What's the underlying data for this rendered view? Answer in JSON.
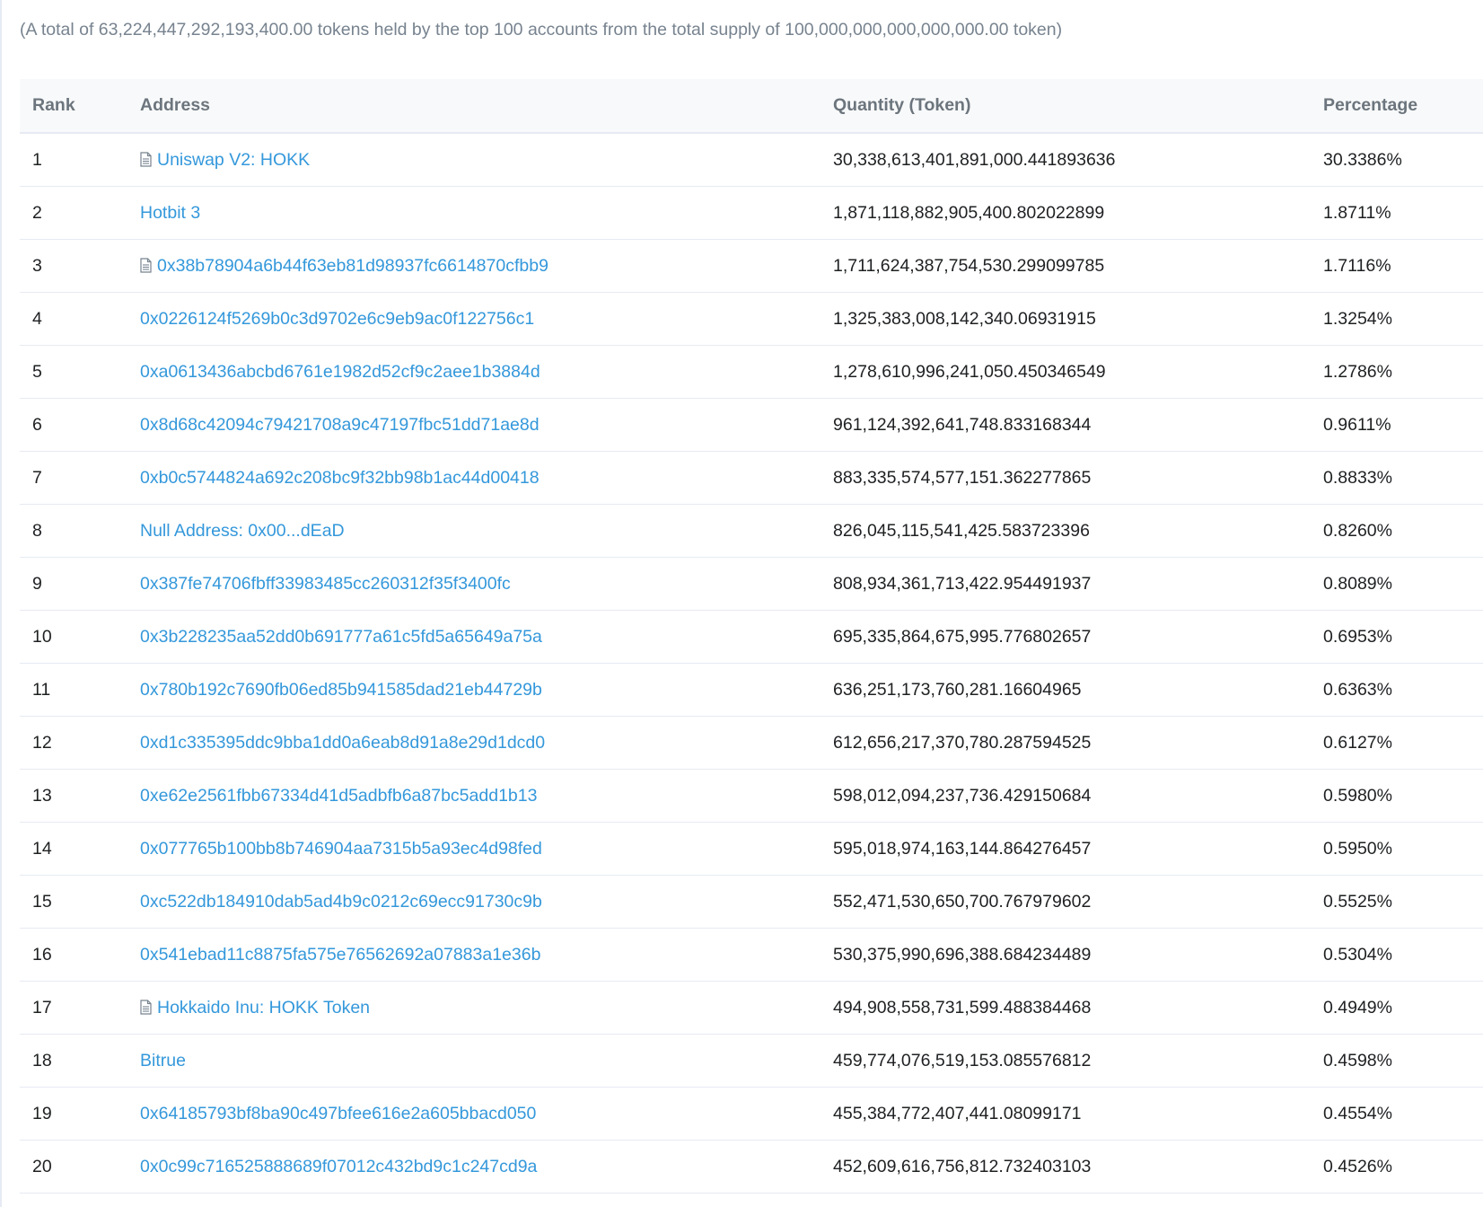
{
  "summary": "(A total of 63,224,447,292,193,400.00 tokens held by the top 100 accounts from the total supply of 100,000,000,000,000,000.00 token)",
  "columns": {
    "rank": "Rank",
    "address": "Address",
    "quantity": "Quantity (Token)",
    "percentage": "Percentage"
  },
  "rows": [
    {
      "rank": "1",
      "address": "Uniswap V2: HOKK",
      "contract": true,
      "quantity": "30,338,613,401,891,000.441893636",
      "percentage": "30.3386%"
    },
    {
      "rank": "2",
      "address": "Hotbit 3",
      "contract": false,
      "quantity": "1,871,118,882,905,400.802022899",
      "percentage": "1.8711%"
    },
    {
      "rank": "3",
      "address": "0x38b78904a6b44f63eb81d98937fc6614870cfbb9",
      "contract": true,
      "quantity": "1,711,624,387,754,530.299099785",
      "percentage": "1.7116%"
    },
    {
      "rank": "4",
      "address": "0x0226124f5269b0c3d9702e6c9eb9ac0f122756c1",
      "contract": false,
      "quantity": "1,325,383,008,142,340.06931915",
      "percentage": "1.3254%"
    },
    {
      "rank": "5",
      "address": "0xa0613436abcbd6761e1982d52cf9c2aee1b3884d",
      "contract": false,
      "quantity": "1,278,610,996,241,050.450346549",
      "percentage": "1.2786%"
    },
    {
      "rank": "6",
      "address": "0x8d68c42094c79421708a9c47197fbc51dd71ae8d",
      "contract": false,
      "quantity": "961,124,392,641,748.833168344",
      "percentage": "0.9611%"
    },
    {
      "rank": "7",
      "address": "0xb0c5744824a692c208bc9f32bb98b1ac44d00418",
      "contract": false,
      "quantity": "883,335,574,577,151.362277865",
      "percentage": "0.8833%"
    },
    {
      "rank": "8",
      "address": "Null Address: 0x00...dEaD",
      "contract": false,
      "quantity": "826,045,115,541,425.583723396",
      "percentage": "0.8260%"
    },
    {
      "rank": "9",
      "address": "0x387fe74706fbff33983485cc260312f35f3400fc",
      "contract": false,
      "quantity": "808,934,361,713,422.954491937",
      "percentage": "0.8089%"
    },
    {
      "rank": "10",
      "address": "0x3b228235aa52dd0b691777a61c5fd5a65649a75a",
      "contract": false,
      "quantity": "695,335,864,675,995.776802657",
      "percentage": "0.6953%"
    },
    {
      "rank": "11",
      "address": "0x780b192c7690fb06ed85b941585dad21eb44729b",
      "contract": false,
      "quantity": "636,251,173,760,281.16604965",
      "percentage": "0.6363%"
    },
    {
      "rank": "12",
      "address": "0xd1c335395ddc9bba1dd0a6eab8d91a8e29d1dcd0",
      "contract": false,
      "quantity": "612,656,217,370,780.287594525",
      "percentage": "0.6127%"
    },
    {
      "rank": "13",
      "address": "0xe62e2561fbb67334d41d5adbfb6a87bc5add1b13",
      "contract": false,
      "quantity": "598,012,094,237,736.429150684",
      "percentage": "0.5980%"
    },
    {
      "rank": "14",
      "address": "0x077765b100bb8b746904aa7315b5a93ec4d98fed",
      "contract": false,
      "quantity": "595,018,974,163,144.864276457",
      "percentage": "0.5950%"
    },
    {
      "rank": "15",
      "address": "0xc522db184910dab5ad4b9c0212c69ecc91730c9b",
      "contract": false,
      "quantity": "552,471,530,650,700.767979602",
      "percentage": "0.5525%"
    },
    {
      "rank": "16",
      "address": "0x541ebad11c8875fa575e76562692a07883a1e36b",
      "contract": false,
      "quantity": "530,375,990,696,388.684234489",
      "percentage": "0.5304%"
    },
    {
      "rank": "17",
      "address": "Hokkaido Inu: HOKK Token",
      "contract": true,
      "quantity": "494,908,558,731,599.488384468",
      "percentage": "0.4949%"
    },
    {
      "rank": "18",
      "address": "Bitrue",
      "contract": false,
      "quantity": "459,774,076,519,153.085576812",
      "percentage": "0.4598%"
    },
    {
      "rank": "19",
      "address": "0x64185793bf8ba90c497bfee616e2a605bbacd050",
      "contract": false,
      "quantity": "455,384,772,407,441.08099171",
      "percentage": "0.4554%"
    },
    {
      "rank": "20",
      "address": "0x0c99c716525888689f07012c432bd9c1c247cd9a",
      "contract": false,
      "quantity": "452,609,616,756,812.732403103",
      "percentage": "0.4526%"
    }
  ],
  "icons": {
    "contract": "contract-document-icon"
  },
  "colors": {
    "link": "#3498db",
    "muted": "#77838f",
    "header_text": "#6c757d",
    "header_bg": "#f8f9fa",
    "border": "#e7eaf3",
    "text": "#1e2022"
  }
}
